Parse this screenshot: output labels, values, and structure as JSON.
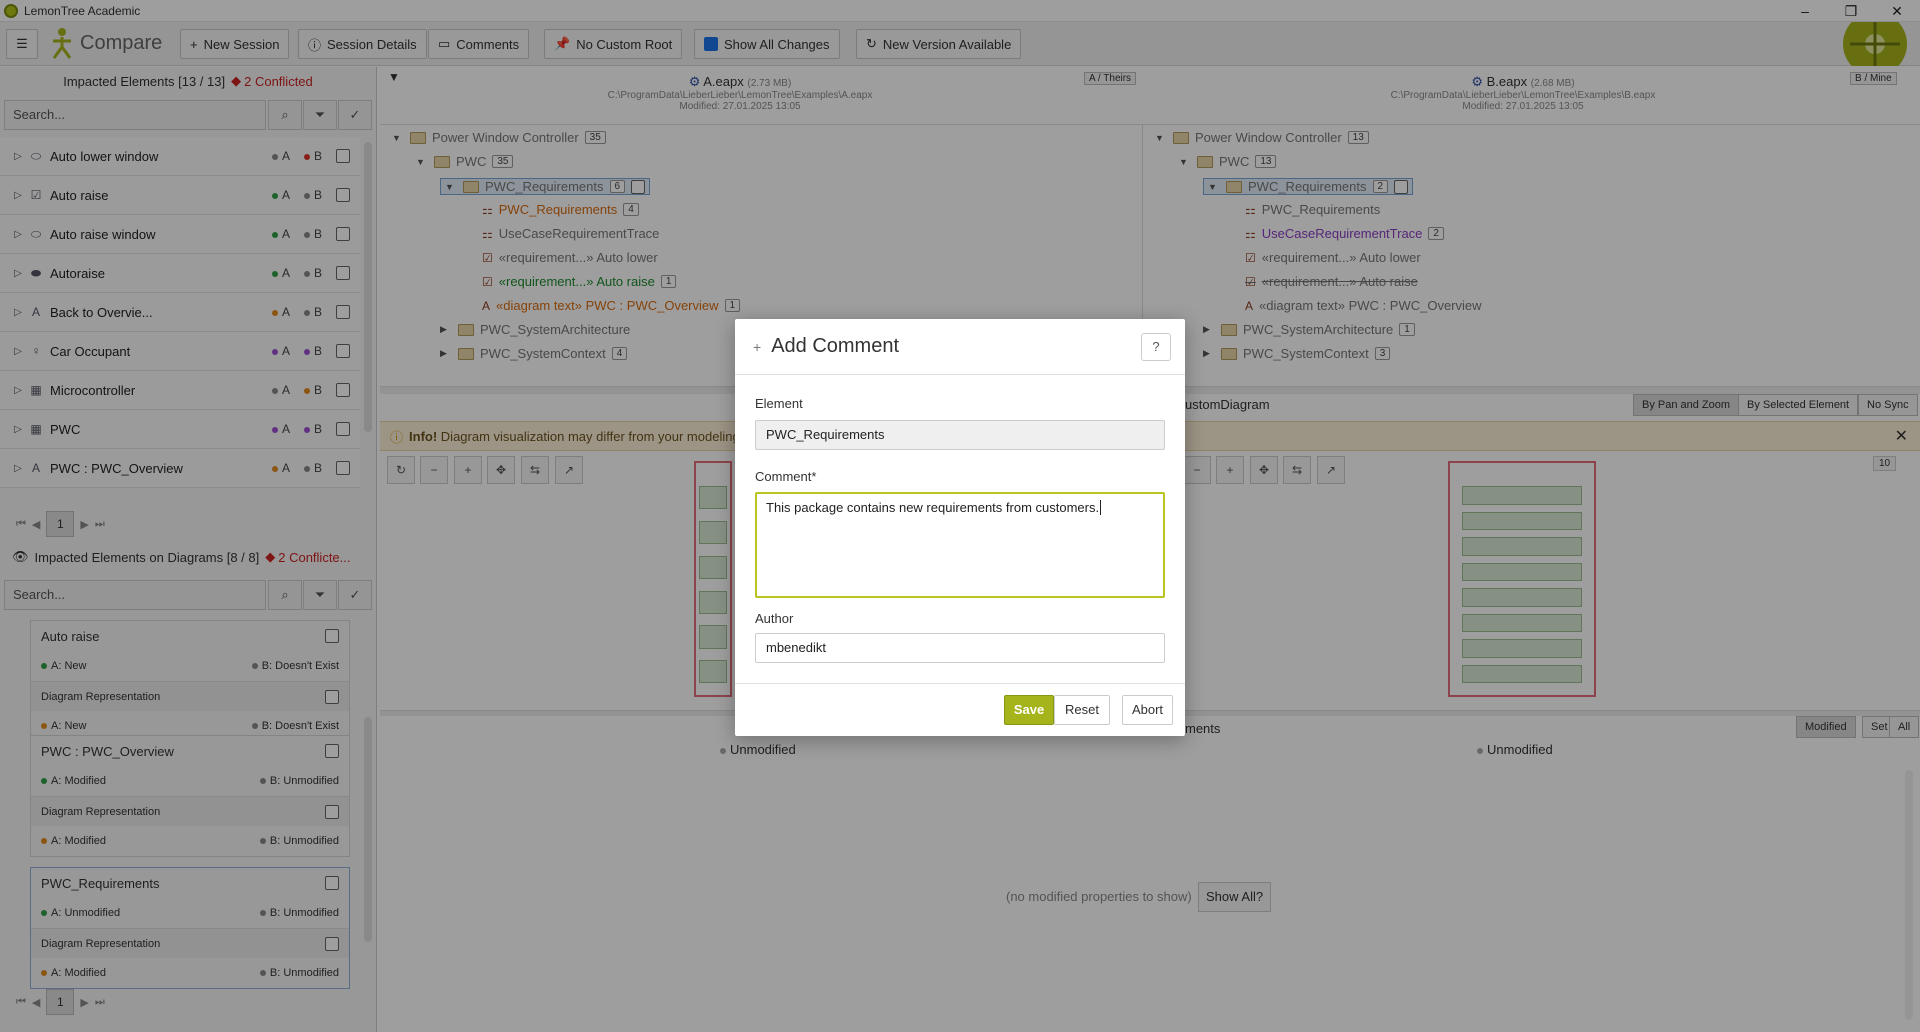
{
  "app": {
    "title": "LemonTree Academic"
  },
  "toolbar": {
    "compare_label": "Compare",
    "new_session": "New Session",
    "session_details": "Session Details",
    "comments": "Comments",
    "no_custom_root": "No Custom Root",
    "show_all_changes": "Show All Changes",
    "new_version": "New Version Available"
  },
  "left_panel": {
    "header": "Impacted Elements [13 / 13]",
    "conflicted": "2 Conflicted",
    "search_placeholder": "Search...",
    "items": [
      {
        "label": "Auto lower window",
        "a_color": "#888888",
        "b_color": "#d9342b"
      },
      {
        "label": "Auto raise",
        "a_color": "#2e9e44",
        "b_color": "#888888"
      },
      {
        "label": "Auto raise window",
        "a_color": "#2e9e44",
        "b_color": "#888888"
      },
      {
        "label": "Autoraise",
        "a_color": "#2e9e44",
        "b_color": "#888888"
      },
      {
        "label": "Back to Overvie...",
        "a_color": "#e08a1e",
        "b_color": "#888888"
      },
      {
        "label": "Car Occupant",
        "a_color": "#9b4fd3",
        "b_color": "#9b4fd3"
      },
      {
        "label": "Microcontroller",
        "a_color": "#888888",
        "b_color": "#e08a1e"
      },
      {
        "label": "PWC",
        "a_color": "#9b4fd3",
        "b_color": "#9b4fd3"
      },
      {
        "label": "PWC : PWC_Overview",
        "a_color": "#e08a1e",
        "b_color": "#888888"
      }
    ],
    "a_label": "A",
    "b_label": "B",
    "page": "1"
  },
  "diagram_panel": {
    "header": "Impacted Elements on Diagrams [8 / 8]",
    "conflicted": "2 Conflicte...",
    "search_placeholder": "Search...",
    "cards": [
      {
        "title": "Auto raise",
        "a": "A: New",
        "b": "B: Doesn't Exist",
        "sub": "Diagram Representation",
        "sub_a": "A: New",
        "sub_b": "B: Doesn't Exist"
      },
      {
        "title": "PWC : PWC_Overview",
        "a": "A: Modified",
        "b": "B: Unmodified",
        "sub": "Diagram Representation",
        "sub_a": "A: Modified",
        "sub_b": "B: Unmodified"
      },
      {
        "title": "PWC_Requirements",
        "a": "A: Unmodified",
        "b": "B: Unmodified",
        "sub": "Diagram Representation",
        "sub_a": "A: Modified",
        "sub_b": "B: Unmodified"
      }
    ],
    "page": "1"
  },
  "tree_a": {
    "file": "A.eapx",
    "size": "(2.73 MB)",
    "path": "C:\\ProgramData\\LieberLieber\\LemonTree\\Examples\\A.eapx",
    "modified": "Modified: 27.01.2025 13:05",
    "tag": "A / Theirs",
    "rows": [
      {
        "label": "Power Window Controller",
        "count": "35"
      },
      {
        "label": "PWC",
        "count": "35"
      },
      {
        "label": "PWC_Requirements",
        "count": "6"
      },
      {
        "label": "PWC_Requirements",
        "count": "4"
      },
      {
        "label": "UseCaseRequirementTrace",
        "count": ""
      },
      {
        "label": "«requirement...» Auto lower",
        "count": ""
      },
      {
        "label": "«requirement...» Auto raise",
        "count": "1"
      },
      {
        "label": "«diagram text» PWC : PWC_Overview",
        "count": "1"
      },
      {
        "label": "PWC_SystemArchitecture",
        "count": ""
      },
      {
        "label": "PWC_SystemContext",
        "count": "4"
      }
    ]
  },
  "tree_b": {
    "file": "B.eapx",
    "size": "(2.68 MB)",
    "path": "C:\\ProgramData\\LieberLieber\\LemonTree\\Examples\\B.eapx",
    "modified": "Modified: 27.01.2025 13:05",
    "tag": "B / Mine",
    "rows": [
      {
        "label": "Power Window Controller",
        "count": "13"
      },
      {
        "label": "PWC",
        "count": "13"
      },
      {
        "label": "PWC_Requirements",
        "count": "2"
      },
      {
        "label": "PWC_Requirements",
        "count": ""
      },
      {
        "label": "UseCaseRequirementTrace",
        "count": "2"
      },
      {
        "label": "«requirement...» Auto lower",
        "count": ""
      },
      {
        "label": "«requirement...» Auto raise",
        "count": ""
      },
      {
        "label": "«diagram text» PWC : PWC_Overview",
        "count": ""
      },
      {
        "label": "PWC_SystemArchitecture",
        "count": "1"
      },
      {
        "label": "PWC_SystemContext",
        "count": "3"
      }
    ]
  },
  "diagram_view": {
    "title_fragment": "ustomDiagram",
    "sync": [
      "By Pan and Zoom",
      "By Selected Element",
      "No Sync"
    ],
    "info_bold": "Info!",
    "info_text": "Diagram visualization may differ from your modeling",
    "zoom_badge": "10"
  },
  "properties": {
    "title_fragment": "ments",
    "filters": [
      "Modified",
      "Set",
      "All"
    ],
    "a_status": "Unmodified",
    "b_status": "Unmodified",
    "empty": "(no modified properties to show)",
    "show_all": "Show All?"
  },
  "dialog": {
    "title": "Add Comment",
    "element_label": "Element",
    "element_value": "PWC_Requirements",
    "comment_label": "Comment*",
    "comment_value": "This package contains new requirements from customers.",
    "author_label": "Author",
    "author_value": "mbenedikt",
    "save": "Save",
    "reset": "Reset",
    "abort": "Abort"
  },
  "colors": {
    "accent": "#a6b41b",
    "conflict": "#cc2222",
    "modified": "#d86c10",
    "added": "#1f8a2e",
    "moved": "#8c3cc4"
  }
}
